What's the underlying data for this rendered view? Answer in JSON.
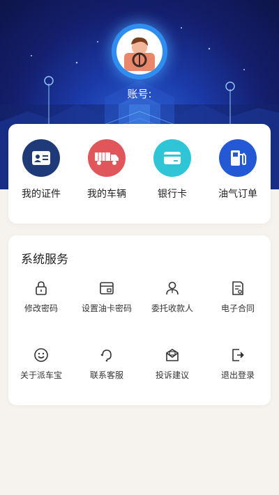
{
  "header": {
    "account_label": "账号:",
    "account_value": ""
  },
  "quick_actions": [
    {
      "label": "我的证件",
      "icon": "id-card-icon",
      "color": "#1e3a78"
    },
    {
      "label": "我的车辆",
      "icon": "truck-icon",
      "color": "#e0565a"
    },
    {
      "label": "银行卡",
      "icon": "bank-card-icon",
      "color": "#2ec5d6"
    },
    {
      "label": "油气订单",
      "icon": "fuel-pump-icon",
      "color": "#2459d6"
    }
  ],
  "services": {
    "title": "系统服务",
    "items": [
      {
        "label": "修改密码",
        "icon": "lock-icon"
      },
      {
        "label": "设置油卡密码",
        "icon": "card-lock-icon"
      },
      {
        "label": "委托收款人",
        "icon": "person-icon"
      },
      {
        "label": "电子合同",
        "icon": "contract-icon"
      },
      {
        "label": "关于派车宝",
        "icon": "smiley-icon"
      },
      {
        "label": "联系客服",
        "icon": "customer-service-icon"
      },
      {
        "label": "投诉建议",
        "icon": "complaint-mail-icon"
      },
      {
        "label": "退出登录",
        "icon": "logout-icon"
      }
    ]
  }
}
